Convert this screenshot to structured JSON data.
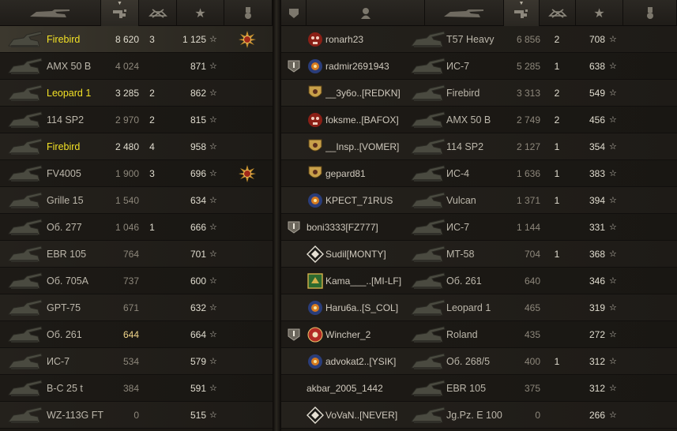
{
  "left": {
    "header": {
      "columns": [
        {
          "name": "vehicle",
          "icon": "tank-icon"
        },
        {
          "name": "damage",
          "icon": "damage-icon",
          "sorted": true
        },
        {
          "name": "kills",
          "icon": "destroyed-tank-icon"
        },
        {
          "name": "xp",
          "icon": "star-icon"
        },
        {
          "name": "medals",
          "icon": "medal-icon"
        }
      ]
    },
    "rows": [
      {
        "vehicle": "Firebird",
        "damage": "8 620",
        "kills": "3",
        "xp": "1 125",
        "medal": true,
        "highlight": true,
        "me": true
      },
      {
        "vehicle": "AMX 50 B",
        "damage": "4 024",
        "kills": "",
        "xp": "871",
        "medal": false,
        "highlight": false
      },
      {
        "vehicle": "Leopard 1",
        "damage": "3 285",
        "kills": "2",
        "xp": "862",
        "medal": false,
        "highlight": true
      },
      {
        "vehicle": "114 SP2",
        "damage": "2 970",
        "kills": "2",
        "xp": "815",
        "medal": false,
        "highlight": false
      },
      {
        "vehicle": "Firebird",
        "damage": "2 480",
        "kills": "4",
        "xp": "958",
        "medal": false,
        "highlight": true
      },
      {
        "vehicle": "FV4005",
        "damage": "1 900",
        "kills": "3",
        "xp": "696",
        "medal": true,
        "highlight": false
      },
      {
        "vehicle": "Grille 15",
        "damage": "1 540",
        "kills": "",
        "xp": "634",
        "medal": false,
        "highlight": false
      },
      {
        "vehicle": "Об. 277",
        "damage": "1 046",
        "kills": "1",
        "xp": "666",
        "medal": false,
        "highlight": false
      },
      {
        "vehicle": "EBR 105",
        "damage": "764",
        "kills": "",
        "xp": "701",
        "medal": false,
        "highlight": false
      },
      {
        "vehicle": "Об. 705А",
        "damage": "737",
        "kills": "",
        "xp": "600",
        "medal": false,
        "highlight": false
      },
      {
        "vehicle": "GPT-75",
        "damage": "671",
        "kills": "",
        "xp": "632",
        "medal": false,
        "highlight": false
      },
      {
        "vehicle": "Об. 261",
        "damage": "644",
        "kills": "",
        "xp": "664",
        "medal": false,
        "highlight": false,
        "selected": true
      },
      {
        "vehicle": "ИС-7",
        "damage": "534",
        "kills": "",
        "xp": "579",
        "medal": false,
        "highlight": false
      },
      {
        "vehicle": "B-C 25 t",
        "damage": "384",
        "kills": "",
        "xp": "591",
        "medal": false,
        "highlight": false
      },
      {
        "vehicle": "WZ-113G FT",
        "damage": "0",
        "kills": "",
        "xp": "515",
        "medal": false,
        "highlight": false
      }
    ]
  },
  "right": {
    "header": {
      "columns": [
        {
          "name": "platoon",
          "icon": "platoon-icon"
        },
        {
          "name": "player",
          "icon": "player-icon"
        },
        {
          "name": "vehicle",
          "icon": "tank-icon"
        },
        {
          "name": "damage",
          "icon": "damage-icon",
          "sorted": true
        },
        {
          "name": "kills",
          "icon": "destroyed-tank-icon"
        },
        {
          "name": "xp",
          "icon": "star-icon"
        },
        {
          "name": "medals",
          "icon": "medal-icon"
        }
      ]
    },
    "rows": [
      {
        "platoon": false,
        "player": "ronarh23",
        "badge": "red-skull",
        "vehicle": "T57 Heavy",
        "damage": "6 856",
        "kills": "2",
        "xp": "708"
      },
      {
        "platoon": true,
        "player": "radmir2691943",
        "badge": "blue-orange",
        "vehicle": "ИС-7",
        "damage": "5 285",
        "kills": "1",
        "xp": "638"
      },
      {
        "platoon": false,
        "player": "__3y6o..[REDKN]",
        "badge": "gold-shield",
        "vehicle": "Firebird",
        "damage": "3 313",
        "kills": "2",
        "xp": "549"
      },
      {
        "platoon": false,
        "player": "foksme..[BAFOX]",
        "badge": "red-skull",
        "vehicle": "AMX 50 B",
        "damage": "2 749",
        "kills": "2",
        "xp": "456"
      },
      {
        "platoon": false,
        "player": "__Insp..[VOMER]",
        "badge": "gold-shield",
        "vehicle": "114 SP2",
        "damage": "2 127",
        "kills": "1",
        "xp": "354"
      },
      {
        "platoon": false,
        "player": "gepard81",
        "badge": "gold-shield",
        "vehicle": "ИС-4",
        "damage": "1 636",
        "kills": "1",
        "xp": "383"
      },
      {
        "platoon": false,
        "player": "KPECT_71RUS",
        "badge": "blue-orange",
        "vehicle": "Vulcan",
        "damage": "1 371",
        "kills": "1",
        "xp": "394"
      },
      {
        "platoon": true,
        "player": "boni3333[FZ777]",
        "badge": "",
        "vehicle": "ИС-7",
        "damage": "1 144",
        "kills": "",
        "xp": "331"
      },
      {
        "platoon": false,
        "player": "Sudil[MONTY]",
        "badge": "white-diamond",
        "vehicle": "MT-58",
        "damage": "704",
        "kills": "1",
        "xp": "368"
      },
      {
        "platoon": false,
        "player": "Kama___..[MI-LF]",
        "badge": "green-gold",
        "vehicle": "Об. 261",
        "damage": "640",
        "kills": "",
        "xp": "346"
      },
      {
        "platoon": false,
        "player": "Haru6a..[S_COL]",
        "badge": "blue-orange",
        "vehicle": "Leopard 1",
        "damage": "465",
        "kills": "",
        "xp": "319"
      },
      {
        "platoon": true,
        "player": "Wincher_2",
        "badge": "red-circle",
        "vehicle": "Roland",
        "damage": "435",
        "kills": "",
        "xp": "272"
      },
      {
        "platoon": false,
        "player": "advokat2..[YSIK]",
        "badge": "blue-orange",
        "vehicle": "Об. 268/5",
        "damage": "400",
        "kills": "1",
        "xp": "312"
      },
      {
        "platoon": false,
        "player": "akbar_2005_1442",
        "badge": "",
        "vehicle": "EBR 105",
        "damage": "375",
        "kills": "",
        "xp": "312"
      },
      {
        "platoon": false,
        "player": "VoVaN..[NEVER]",
        "badge": "white-diamond",
        "vehicle": "Jg.Pz. E 100",
        "damage": "0",
        "kills": "",
        "xp": "266"
      }
    ]
  },
  "colors": {
    "highlight_name": "#f2e126",
    "bright_number": "#e0dccf",
    "dim_number": "#8d877b"
  }
}
